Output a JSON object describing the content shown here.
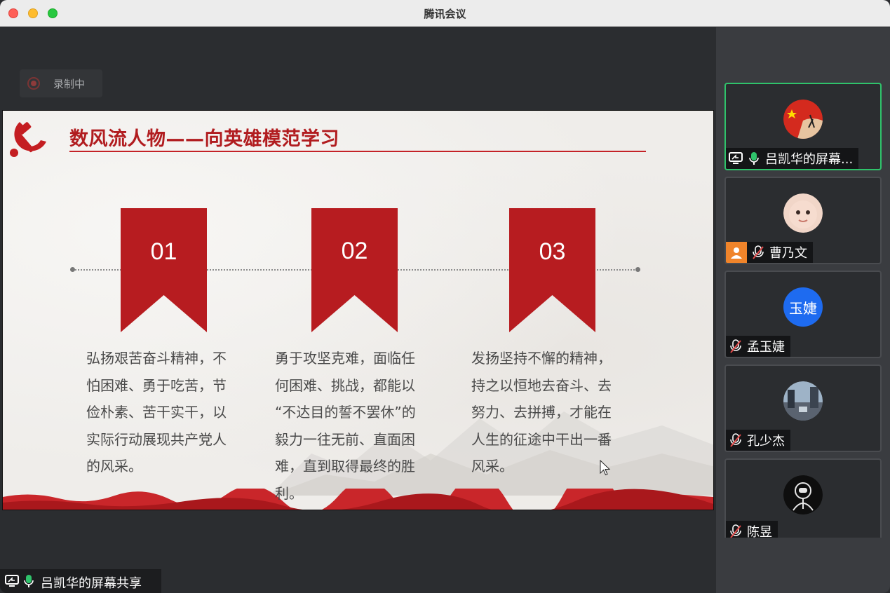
{
  "window": {
    "title": "腾讯会议"
  },
  "recording": {
    "label": "录制中"
  },
  "slide": {
    "title": "数风流人物——向英雄模范学习",
    "columns": [
      {
        "number": "01",
        "lines": [
          "弘扬艰苦奋斗精神，不",
          "怕困难、勇于吃苦，节",
          "俭朴素、苦干实干，以",
          "实际行动展现共产党人",
          "的风采。"
        ]
      },
      {
        "number": "02",
        "lines": [
          "勇于攻坚克难，面临任",
          "何困难、挑战，都能以",
          "“不达目的誓不罢休”的",
          "毅力一往无前、直面困",
          "难，直到取得最终的胜",
          "利。"
        ]
      },
      {
        "number": "03",
        "lines": [
          "发扬坚持不懈的精神，",
          "持之以恒地去奋斗、去",
          "努力、去拼搏，才能在",
          "人生的征途中干出一番",
          "风采。"
        ]
      }
    ]
  },
  "screen_share": {
    "label": "吕凯华的屏幕共享"
  },
  "participants": [
    {
      "name": "吕凯华的屏幕...",
      "mic": "on",
      "sharing": true,
      "active": true,
      "avatar": "flag-avatar"
    },
    {
      "name": "曹乃文",
      "mic": "muted",
      "host": true,
      "avatar": "child-photo-avatar"
    },
    {
      "name": "孟玉婕",
      "mic": "muted",
      "avatar_text": "玉婕"
    },
    {
      "name": "孔少杰",
      "mic": "muted",
      "avatar": "street-photo-avatar"
    },
    {
      "name": "陈昱",
      "mic": "muted",
      "avatar": "astronaut-avatar"
    }
  ],
  "colors": {
    "accent_green": "#2fc36b",
    "slide_red": "#b11c1f",
    "host_orange": "#f0842a",
    "avatar_blue": "#1e6bf0"
  }
}
